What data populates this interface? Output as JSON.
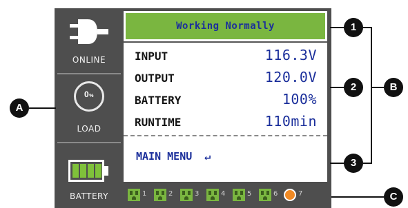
{
  "device": {
    "side_panel": {
      "online_label": "ONLINE",
      "load_label": "LOAD",
      "load_value": "0",
      "load_unit": "%",
      "battery_label": "BATTERY",
      "battery_level_bars": 4,
      "battery_level_max": 4
    },
    "lcd": {
      "status": "Working Normally",
      "readings": [
        {
          "label": "INPUT",
          "value": "116.3V"
        },
        {
          "label": "OUTPUT",
          "value": "120.0V"
        },
        {
          "label": "BATTERY",
          "value": "100%"
        },
        {
          "label": "RUNTIME",
          "value": "110min"
        }
      ],
      "menu_label": "MAIN MENU",
      "enter_glyph": "↵"
    },
    "outlets": [
      {
        "number": "1",
        "kind": "socket"
      },
      {
        "number": "2",
        "kind": "socket"
      },
      {
        "number": "3",
        "kind": "socket"
      },
      {
        "number": "4",
        "kind": "socket"
      },
      {
        "number": "5",
        "kind": "socket"
      },
      {
        "number": "6",
        "kind": "socket"
      },
      {
        "number": "7",
        "kind": "usb-round"
      }
    ]
  },
  "callouts": {
    "one": "1",
    "two": "2",
    "three": "3",
    "a": "A",
    "b": "B",
    "c": "C"
  },
  "colors": {
    "frame": "#4e4e4e",
    "status_green": "#7ab640",
    "value_blue": "#1b2f9b",
    "battery_green": "#7fc13a",
    "outlet_orange": "#f08a24",
    "callout_black": "#111111"
  },
  "icons": {
    "online": "plug-icon",
    "load": "load-ring-icon",
    "battery": "battery-icon",
    "enter": "enter-return-icon"
  }
}
